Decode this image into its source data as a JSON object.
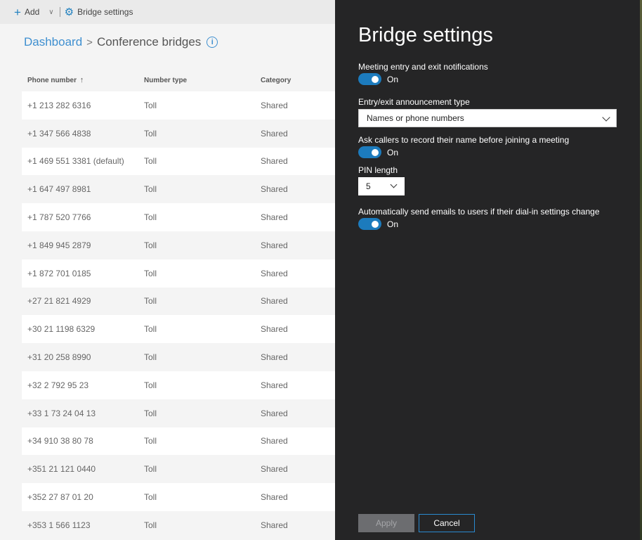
{
  "command_bar": {
    "add_label": "Add",
    "bridge_settings_label": "Bridge settings"
  },
  "breadcrumb": {
    "dashboard": "Dashboard",
    "separator": ">",
    "current": "Conference bridges"
  },
  "table": {
    "headers": {
      "phone": "Phone number",
      "type": "Number type",
      "category": "Category"
    },
    "rows": [
      {
        "phone": "+1 213 282 6316",
        "type": "Toll",
        "category": "Shared"
      },
      {
        "phone": "+1 347 566 4838",
        "type": "Toll",
        "category": "Shared"
      },
      {
        "phone": "+1 469 551 3381 (default)",
        "type": "Toll",
        "category": "Shared"
      },
      {
        "phone": "+1 647 497 8981",
        "type": "Toll",
        "category": "Shared"
      },
      {
        "phone": "+1 787 520 7766",
        "type": "Toll",
        "category": "Shared"
      },
      {
        "phone": "+1 849 945 2879",
        "type": "Toll",
        "category": "Shared"
      },
      {
        "phone": "+1 872 701 0185",
        "type": "Toll",
        "category": "Shared"
      },
      {
        "phone": "+27 21 821 4929",
        "type": "Toll",
        "category": "Shared"
      },
      {
        "phone": "+30 21 1198 6329",
        "type": "Toll",
        "category": "Shared"
      },
      {
        "phone": "+31 20 258 8990",
        "type": "Toll",
        "category": "Shared"
      },
      {
        "phone": "+32 2 792 95 23",
        "type": "Toll",
        "category": "Shared"
      },
      {
        "phone": "+33 1 73 24 04 13",
        "type": "Toll",
        "category": "Shared"
      },
      {
        "phone": "+34 910 38 80 78",
        "type": "Toll",
        "category": "Shared"
      },
      {
        "phone": "+351 21 121 0440",
        "type": "Toll",
        "category": "Shared"
      },
      {
        "phone": "+352 27 87 01 20",
        "type": "Toll",
        "category": "Shared"
      },
      {
        "phone": "+353 1 566 1123",
        "type": "Toll",
        "category": "Shared"
      }
    ]
  },
  "panel": {
    "title": "Bridge settings",
    "notifications": {
      "label": "Meeting entry and exit notifications",
      "state": "On"
    },
    "announcement": {
      "label": "Entry/exit announcement type",
      "value": "Names or phone numbers"
    },
    "record_name": {
      "label": "Ask callers to record their name before joining a meeting",
      "state": "On"
    },
    "pin": {
      "label": "PIN length",
      "value": "5"
    },
    "emails": {
      "label": "Automatically send emails to users if their dial-in settings change",
      "state": "On"
    },
    "apply_label": "Apply",
    "cancel_label": "Cancel"
  },
  "colors": {
    "accent": "#1c7bbd",
    "panel_bg": "#252526",
    "link": "#3e8fd0"
  }
}
